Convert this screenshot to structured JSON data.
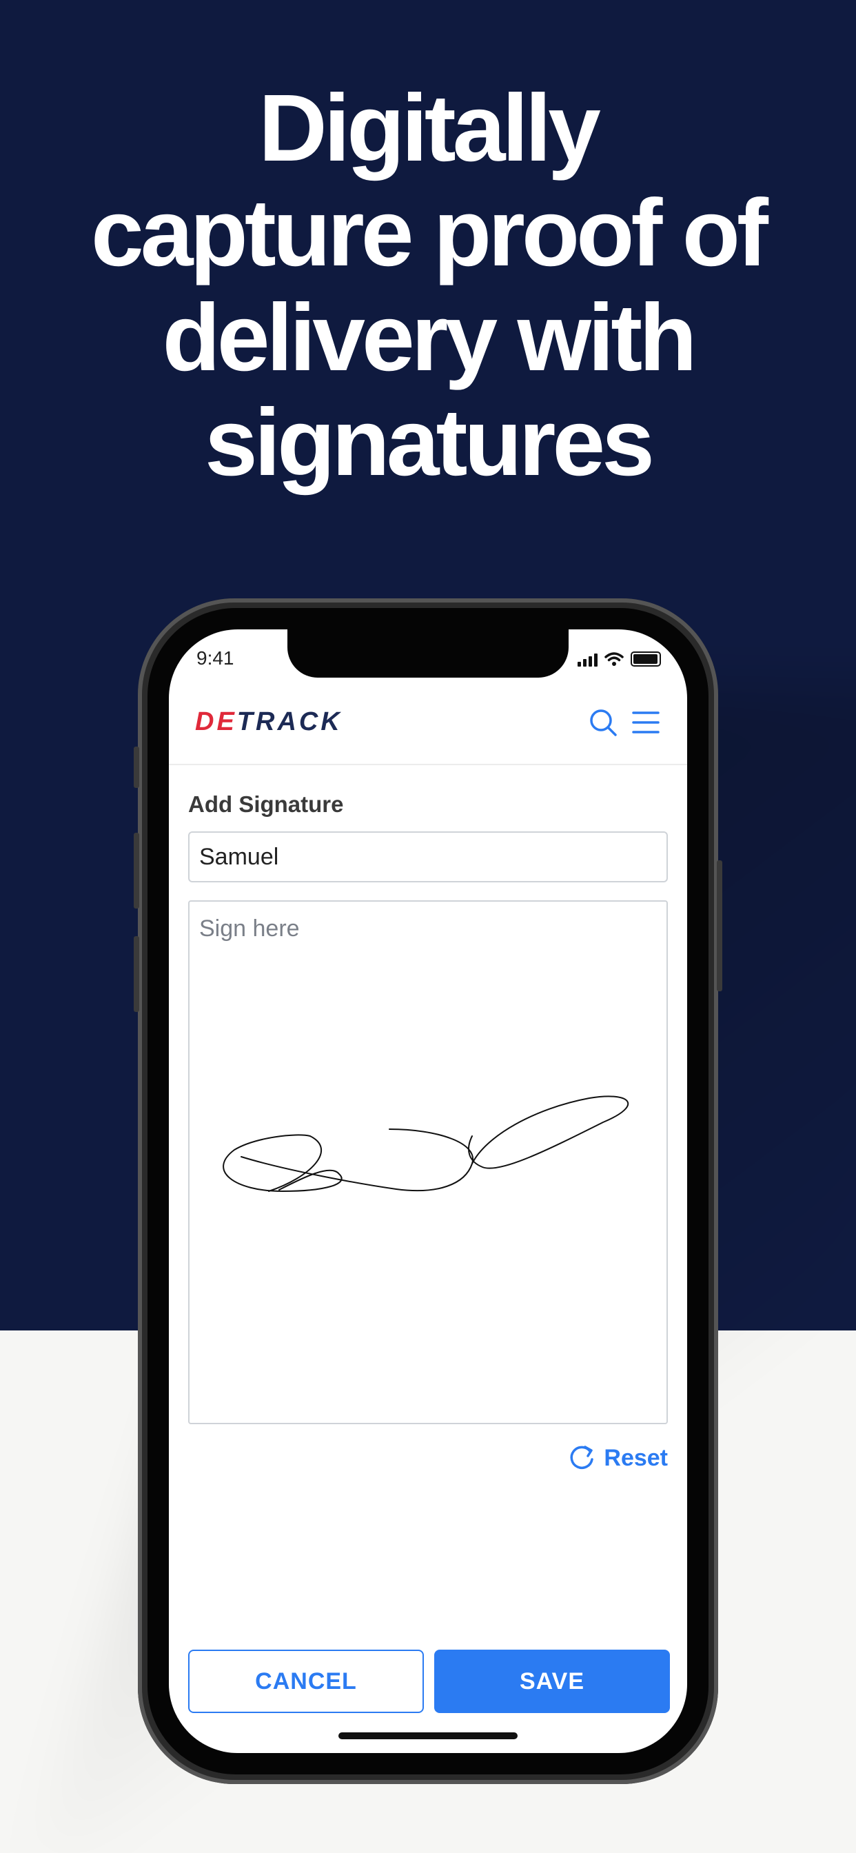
{
  "headline": {
    "lines": [
      "Digitally",
      "capture proof of",
      "delivery with",
      "signatures"
    ]
  },
  "status_bar": {
    "time": "9:41"
  },
  "app": {
    "logo_part1": "DE",
    "logo_part2": "TRACK",
    "icons": [
      "search-icon",
      "menu-icon"
    ]
  },
  "form": {
    "title": "Add Signature",
    "name_value": "Samuel",
    "sign_placeholder": "Sign here",
    "reset_label": "Reset",
    "cancel_label": "CANCEL",
    "save_label": "SAVE"
  },
  "colors": {
    "hero_background": "#0f1a3f",
    "accent_blue": "#2b7bf2",
    "brand_red": "#e0293a"
  }
}
